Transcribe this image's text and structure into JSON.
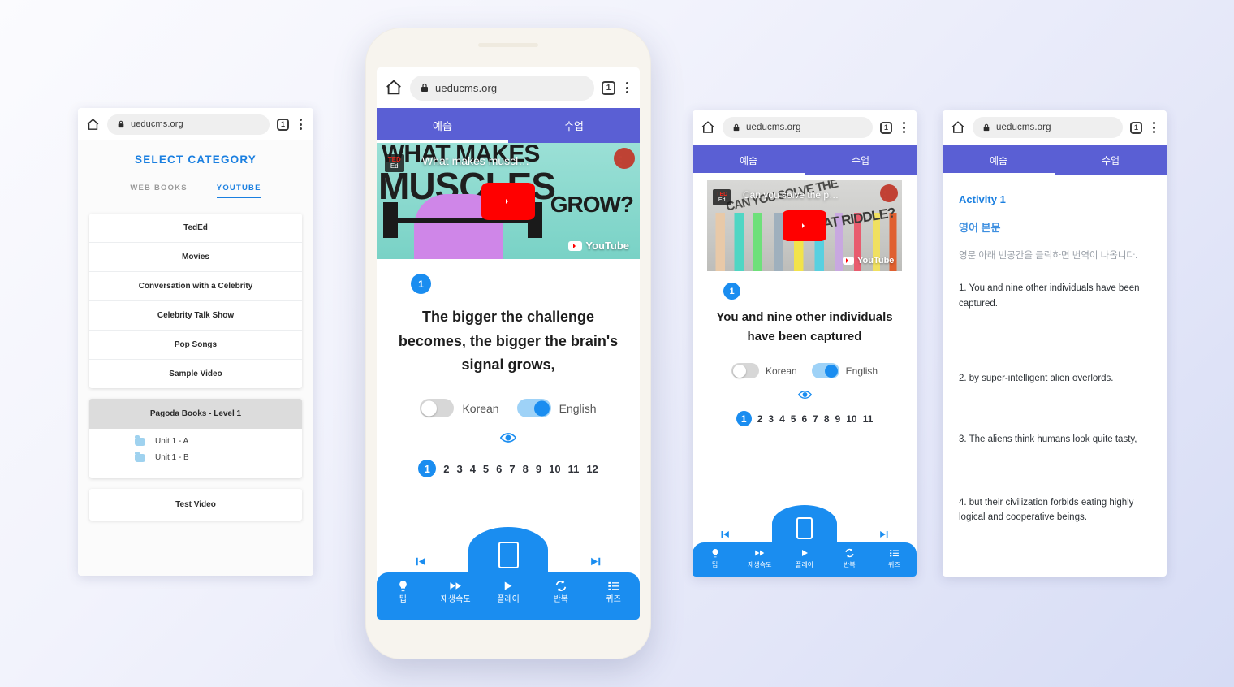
{
  "theme": {
    "app_tabbar_color": "#5a5fd4",
    "accent_blue": "#1a8df0",
    "link_blue": "#1a7fe0",
    "toolbar_blue": "#1a8df0",
    "youtube_red": "#ff0000"
  },
  "browser": {
    "url": "ueducms.org",
    "tab_count": "1",
    "home_icon": "home-icon",
    "lock_icon": "lock-icon",
    "menu_icon": "kebab-menu-icon"
  },
  "app_tabs": {
    "preview": "예습",
    "lesson": "수업",
    "active": "예습"
  },
  "panel1": {
    "title": "SELECT CATEGORY",
    "tabs": [
      {
        "label": "WEB BOOKS",
        "active": false
      },
      {
        "label": "YOUTUBE",
        "active": true
      }
    ],
    "categories": [
      "TedEd",
      "Movies",
      "Conversation with a Celebrity",
      "Celebrity Talk Show",
      "Pop Songs",
      "Sample Video"
    ],
    "group": {
      "header": "Pagoda Books - Level 1",
      "units": [
        {
          "label": "Unit 1 - A",
          "icon": "folder-icon"
        },
        {
          "label": "Unit 1 - B",
          "icon": "folder-icon"
        }
      ]
    },
    "last_item": "Test Video"
  },
  "panel2": {
    "video": {
      "title": "What makes muscl…",
      "channel_top": "TED",
      "channel_bottom": "Ed",
      "watermark": "YouTube",
      "art_words": [
        "WHAT MAKES",
        "MUSCLES",
        "GROW?"
      ],
      "play_icon": "youtube-play-icon"
    },
    "sentence_number": "1",
    "sentence": "The bigger the challenge becomes, the bigger the brain's signal grows,",
    "toggles": [
      {
        "label": "Korean",
        "state": "off"
      },
      {
        "label": "English",
        "state": "on"
      }
    ],
    "eye_icon": "eye-icon",
    "pages": [
      "1",
      "2",
      "3",
      "4",
      "5",
      "6",
      "7",
      "8",
      "9",
      "10",
      "11",
      "12"
    ],
    "current_page": "1",
    "toolbar": [
      {
        "icon": "lightbulb-icon",
        "label": "팁"
      },
      {
        "icon": "fast-forward-icon",
        "label": "재생속도"
      },
      {
        "icon": "play-icon",
        "label": "플레이"
      },
      {
        "icon": "repeat-icon",
        "label": "반복"
      },
      {
        "icon": "list-icon",
        "label": "퀴즈"
      }
    ],
    "hump_icon": "phone-portrait-icon",
    "prev_icon": "skip-previous-icon",
    "next_icon": "skip-next-icon"
  },
  "panel3": {
    "video": {
      "title": "Can you solve the p…",
      "channel_top": "TED",
      "channel_bottom": "Ed",
      "watermark": "YouTube",
      "art_words": [
        "CAN YOU SOLVE THE",
        "HAT RIDDLE?"
      ],
      "play_icon": "youtube-play-icon"
    },
    "sentence_number": "1",
    "sentence": "You and nine other individuals have been captured",
    "toggles": [
      {
        "label": "Korean",
        "state": "off"
      },
      {
        "label": "English",
        "state": "on"
      }
    ],
    "eye_icon": "eye-icon",
    "pages": [
      "1",
      "2",
      "3",
      "4",
      "5",
      "6",
      "7",
      "8",
      "9",
      "10",
      "11"
    ],
    "current_page": "1",
    "toolbar": [
      {
        "icon": "lightbulb-icon",
        "label": "팁"
      },
      {
        "icon": "fast-forward-icon",
        "label": "재생속도"
      },
      {
        "icon": "play-icon",
        "label": "플레이"
      },
      {
        "icon": "repeat-icon",
        "label": "반복"
      },
      {
        "icon": "list-icon",
        "label": "퀴즈"
      }
    ],
    "hump_icon": "phone-portrait-icon",
    "prev_icon": "skip-previous-icon",
    "next_icon": "skip-next-icon"
  },
  "panel4": {
    "activity_title": "Activity 1",
    "section_title": "영어 본문",
    "note": "영문 아래 빈공간을 클릭하면 번역이 나옵니다.",
    "lines": [
      "1. You and nine other individuals have been captured.",
      "2. by super-intelligent alien overlords.",
      "3. The aliens think humans look quite tasty,",
      "4. but their civilization forbids eating highly logical and cooperative beings."
    ]
  }
}
